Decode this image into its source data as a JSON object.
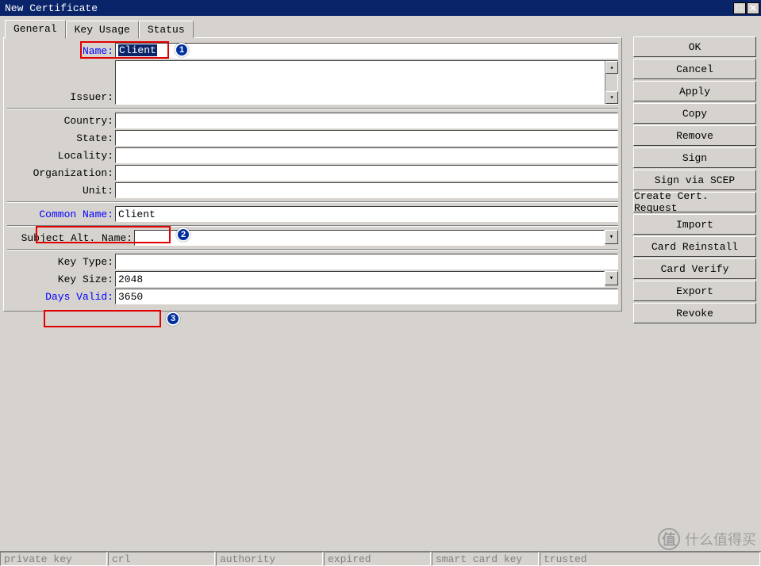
{
  "title": "New Certificate",
  "tabs": {
    "general": "General",
    "key_usage": "Key Usage",
    "status": "Status"
  },
  "fields": {
    "name": {
      "label": "Name:",
      "value": "Client"
    },
    "issuer": {
      "label": "Issuer:"
    },
    "country": {
      "label": "Country:",
      "value": ""
    },
    "state": {
      "label": "State:",
      "value": ""
    },
    "locality": {
      "label": "Locality:",
      "value": ""
    },
    "organization": {
      "label": "Organization:",
      "value": ""
    },
    "unit": {
      "label": "Unit:",
      "value": ""
    },
    "common_name": {
      "label": "Common Name:",
      "value": "Client"
    },
    "san": {
      "label": "Subject Alt. Name:",
      "value": ""
    },
    "key_type": {
      "label": "Key Type:",
      "value": ""
    },
    "key_size": {
      "label": "Key Size:",
      "value": "2048"
    },
    "days_valid": {
      "label": "Days Valid:",
      "value": "3650"
    }
  },
  "buttons": {
    "ok": "OK",
    "cancel": "Cancel",
    "apply": "Apply",
    "copy": "Copy",
    "remove": "Remove",
    "sign": "Sign",
    "sign_scep": "Sign via SCEP",
    "create_req": "Create Cert. Request",
    "import": "Import",
    "card_reinstall": "Card Reinstall",
    "card_verify": "Card Verify",
    "export": "Export",
    "revoke": "Revoke"
  },
  "badges": {
    "b1": "1",
    "b2": "2",
    "b3": "3"
  },
  "status": {
    "private_key": "private key",
    "crl": "crl",
    "authority": "authority",
    "expired": "expired",
    "smart_card_key": "smart card key",
    "trusted": "trusted"
  },
  "watermark": {
    "z": "值",
    "text": "什么值得买"
  }
}
